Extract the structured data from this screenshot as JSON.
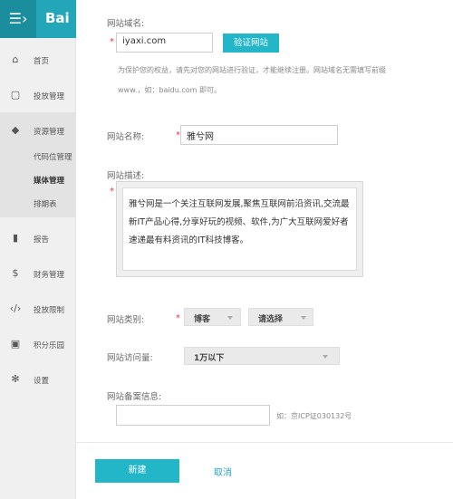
{
  "sidebar": {
    "logo": "Bai",
    "menu_icon": "menu-icon",
    "items": [
      {
        "label": "首页",
        "icon": "home-icon"
      },
      {
        "label": "投放管理",
        "icon": "screen-icon"
      },
      {
        "label": "资源管理",
        "icon": "cube-icon"
      },
      {
        "label": "报告",
        "icon": "bar-chart-icon"
      },
      {
        "label": "财务管理",
        "icon": "dollar-icon"
      },
      {
        "label": "投放限制",
        "icon": "code-icon"
      },
      {
        "label": "积分乐园",
        "icon": "gift-icon"
      },
      {
        "label": "设置",
        "icon": "gear-icon"
      }
    ],
    "subitems": [
      {
        "label": "代码位管理"
      },
      {
        "label": "媒体管理"
      },
      {
        "label": "排期表"
      }
    ]
  },
  "form": {
    "domain_label": "网站域名:",
    "domain_value": "iyaxi.com",
    "verify_button": "验证网站",
    "hint_line1": "为保护您的权益，请先对您的网站进行验证，才能继续注册。网站域名无需填写前缀",
    "hint_line2": "www.，如：baidu.com 即可。",
    "name_label": "网站名称:",
    "name_value": "雅兮网",
    "desc_label": "网站描述:",
    "desc_value": "雅兮网是一个关注互联网发展,聚焦互联网前沿资讯,交流最新IT产品心得,分享好玩的视频、软件,为广大互联网爱好者速递最有料资讯的IT科技博客。",
    "type_label": "网站类别:",
    "type_value": "博客",
    "type_sub_value": "请选择",
    "traffic_label": "网站访问量:",
    "traffic_value": "1万以下",
    "icp_label": "网站备案信息:",
    "icp_value": "",
    "icp_hint": "如：京ICP证030132号",
    "required_mark": "*",
    "create_button": "新建",
    "cancel_button": "取消"
  },
  "colors": {
    "accent": "#23b5c8",
    "sidebar_bg": "#f0f0f0",
    "required": "#e4393c"
  }
}
